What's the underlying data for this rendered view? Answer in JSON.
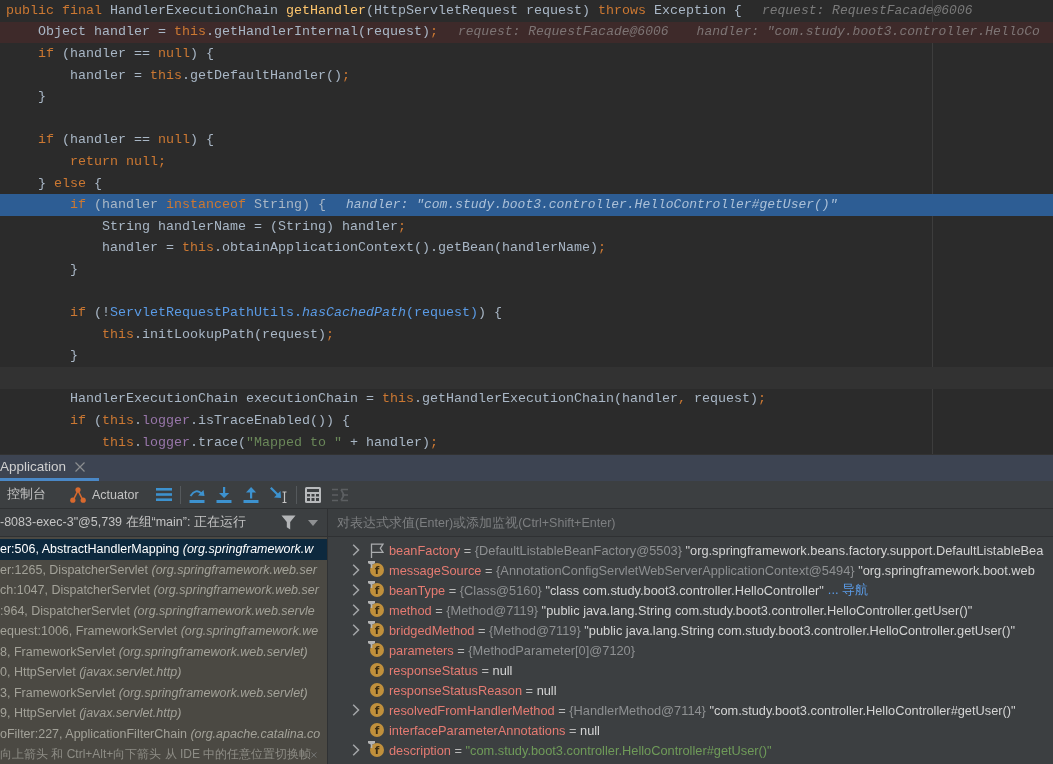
{
  "editor": {
    "lines": [
      {
        "kind": "normal",
        "tokens": [
          {
            "kind": "keyword",
            "text": "public final "
          },
          {
            "kind": "plain",
            "text": "HandlerExecutionChain "
          },
          {
            "kind": "declaration",
            "text": "getHandler"
          },
          {
            "kind": "plain",
            "text": "(HttpServletRequest request) "
          },
          {
            "kind": "keyword",
            "text": "throws "
          },
          {
            "kind": "plain",
            "text": "Exception {"
          }
        ],
        "hints": [
          "request: RequestFacade@6006"
        ]
      },
      {
        "kind": "breakpoint",
        "tokens": [
          {
            "kind": "plain",
            "text": "    Object handler = "
          },
          {
            "kind": "keyword",
            "text": "this"
          },
          {
            "kind": "plain",
            "text": ".getHandlerInternal(request)"
          },
          {
            "kind": "keyword",
            "text": ";"
          }
        ],
        "hints": [
          "request: RequestFacade@6006",
          "handler: \"com.study.boot3.controller.HelloCo"
        ]
      },
      {
        "kind": "normal",
        "tokens": [
          {
            "kind": "keyword",
            "text": "    if"
          },
          {
            "kind": "plain",
            "text": " (handler == "
          },
          {
            "kind": "keyword",
            "text": "null"
          },
          {
            "kind": "plain",
            "text": ") {"
          }
        ]
      },
      {
        "kind": "normal",
        "tokens": [
          {
            "kind": "plain",
            "text": "        handler = "
          },
          {
            "kind": "keyword",
            "text": "this"
          },
          {
            "kind": "plain",
            "text": ".getDefaultHandler()"
          },
          {
            "kind": "keyword",
            "text": ";"
          }
        ]
      },
      {
        "kind": "normal",
        "tokens": [
          {
            "kind": "plain",
            "text": "    }"
          }
        ]
      },
      {
        "kind": "normal"
      },
      {
        "kind": "normal",
        "tokens": [
          {
            "kind": "keyword",
            "text": "    if"
          },
          {
            "kind": "plain",
            "text": " (handler == "
          },
          {
            "kind": "keyword",
            "text": "null"
          },
          {
            "kind": "plain",
            "text": ") {"
          }
        ]
      },
      {
        "kind": "normal",
        "tokens": [
          {
            "kind": "keyword",
            "text": "        return null;"
          }
        ]
      },
      {
        "kind": "normal",
        "tokens": [
          {
            "kind": "plain",
            "text": "    } "
          },
          {
            "kind": "keyword",
            "text": "else"
          },
          {
            "kind": "plain",
            "text": " {"
          }
        ]
      },
      {
        "kind": "execution",
        "tokens": [
          {
            "kind": "keyword",
            "text": "        if"
          },
          {
            "kind": "plain",
            "text": " (handler "
          },
          {
            "kind": "keyword",
            "text": "instanceof"
          },
          {
            "kind": "plain",
            "text": " String) {"
          }
        ],
        "hints": [
          "handler: \"com.study.boot3.controller.HelloController#getUser()\""
        ]
      },
      {
        "kind": "normal",
        "tokens": [
          {
            "kind": "plain",
            "text": "            String handlerName = (String) handler"
          },
          {
            "kind": "keyword",
            "text": ";"
          }
        ]
      },
      {
        "kind": "normal",
        "tokens": [
          {
            "kind": "plain",
            "text": "            handler = "
          },
          {
            "kind": "keyword",
            "text": "this"
          },
          {
            "kind": "plain",
            "text": ".obtainApplicationContext().getBean(handlerName)"
          },
          {
            "kind": "keyword",
            "text": ";"
          }
        ]
      },
      {
        "kind": "normal",
        "tokens": [
          {
            "kind": "plain",
            "text": "        }"
          }
        ]
      },
      {
        "kind": "normal"
      },
      {
        "kind": "normal",
        "tokens": [
          {
            "kind": "keyword",
            "text": "        if"
          },
          {
            "kind": "plain",
            "text": " (!"
          },
          {
            "kind": "reference",
            "text": "ServletRequestPathUtils."
          },
          {
            "kind": "reference-italic",
            "text": "hasCachedPath"
          },
          {
            "kind": "reference",
            "text": "(request)"
          },
          {
            "kind": "plain",
            "text": ") {"
          }
        ]
      },
      {
        "kind": "normal",
        "tokens": [
          {
            "kind": "keyword",
            "text": "            this"
          },
          {
            "kind": "plain",
            "text": ".initLookupPath(request)"
          },
          {
            "kind": "keyword",
            "text": ";"
          }
        ]
      },
      {
        "kind": "normal",
        "tokens": [
          {
            "kind": "plain",
            "text": "        }"
          }
        ]
      },
      {
        "kind": "caret"
      },
      {
        "kind": "normal",
        "tokens": [
          {
            "kind": "plain",
            "text": "        HandlerExecutionChain executionChain = "
          },
          {
            "kind": "keyword",
            "text": "this"
          },
          {
            "kind": "plain",
            "text": ".getHandlerExecutionChain(handler"
          },
          {
            "kind": "keyword",
            "text": ","
          },
          {
            "kind": "plain",
            "text": " request)"
          },
          {
            "kind": "keyword",
            "text": ";"
          }
        ]
      },
      {
        "kind": "normal",
        "tokens": [
          {
            "kind": "keyword",
            "text": "        if"
          },
          {
            "kind": "plain",
            "text": " ("
          },
          {
            "kind": "keyword",
            "text": "this"
          },
          {
            "kind": "plain",
            "text": "."
          },
          {
            "kind": "field",
            "text": "logger"
          },
          {
            "kind": "plain",
            "text": ".isTraceEnabled()) {"
          }
        ]
      },
      {
        "kind": "normal",
        "tokens": [
          {
            "kind": "keyword",
            "text": "            this"
          },
          {
            "kind": "plain",
            "text": "."
          },
          {
            "kind": "field",
            "text": "logger"
          },
          {
            "kind": "plain",
            "text": ".trace("
          },
          {
            "kind": "string",
            "text": "\"Mapped to \""
          },
          {
            "kind": "plain",
            "text": " + handler)"
          },
          {
            "kind": "keyword",
            "text": ";"
          }
        ]
      }
    ]
  },
  "run_tabs": [
    {
      "label": "Application",
      "selected": true
    }
  ],
  "debug_toolbar": {
    "tabs": [
      {
        "kind": "console",
        "label": "控制台",
        "selected": false
      },
      {
        "kind": "actuator",
        "label": "Actuator",
        "selected": false
      }
    ],
    "action_groups": [
      [
        {
          "kind": "layout",
          "disabled": false
        }
      ],
      [
        {
          "kind": "step-over",
          "disabled": false
        },
        {
          "kind": "step-into",
          "disabled": false
        },
        {
          "kind": "step-out",
          "disabled": false
        },
        {
          "kind": "run-to-cursor",
          "disabled": false
        }
      ],
      [
        {
          "kind": "evaluate",
          "disabled": false
        },
        {
          "kind": "trace",
          "disabled": true
        }
      ]
    ]
  },
  "frames": {
    "thread": "-8083-exec-3\"@5,739 在组“main”: 正在运行",
    "items": [
      {
        "label": "er:506, AbstractHandlerMapping *(org.springframework.w*",
        "selected": true
      },
      {
        "label": "er:1265, DispatcherServlet *(org.springframework.web.ser*",
        "selected": false
      },
      {
        "label": "ch:1047, DispatcherServlet *(org.springframework.web.ser*",
        "selected": false
      },
      {
        "label": ":964, DispatcherServlet *(org.springframework.web.servle*",
        "selected": false
      },
      {
        "label": "equest:1006, FrameworkServlet *(org.springframework.we*",
        "selected": false
      },
      {
        "label": "8, FrameworkServlet *(org.springframework.web.servlet)*",
        "selected": false
      },
      {
        "label": "0, HttpServlet *(javax.servlet.http)*",
        "selected": false
      },
      {
        "label": "3, FrameworkServlet *(org.springframework.web.servlet)*",
        "selected": false
      },
      {
        "label": "9, HttpServlet *(javax.servlet.http)*",
        "selected": false
      },
      {
        "label": "oFilter:227, ApplicationFilterChain *(org.apache.catalina.co*",
        "selected": false
      }
    ],
    "tip": "向上箭头 和 Ctrl+Alt+向下箭头 从 IDE 中的任意位置切换帧"
  },
  "variables": {
    "placeholder": "对表达式求值(Enter)或添加监视(Ctrl+Shift+Enter)",
    "items": [
      {
        "kind": "flag",
        "name": "beanFactory",
        "operator": "=",
        "type": "{DefaultListableBeanFactory@5503}",
        "value": "\"org.springframework.beans.factory.support.DefaultListableBea",
        "expandable": true,
        "final": false
      },
      {
        "kind": "field",
        "icon_text": "f",
        "name": "messageSource",
        "operator": "=",
        "type": "{AnnotationConfigServletWebServerApplicationContext@5494}",
        "value": "\"org.springframework.boot.web",
        "expandable": true,
        "final": true
      },
      {
        "kind": "field",
        "icon_text": "f",
        "name": "beanType",
        "operator": "=",
        "type": "{Class@5160}",
        "value": "\"class com.study.boot3.controller.HelloController\"",
        "link": "... 导航",
        "expandable": true,
        "final": true
      },
      {
        "kind": "field",
        "icon_text": "f",
        "name": "method",
        "operator": "=",
        "type": "{Method@7119}",
        "value": "\"public java.lang.String com.study.boot3.controller.HelloController.getUser()\"",
        "expandable": true,
        "final": true
      },
      {
        "kind": "field",
        "icon_text": "f",
        "name": "bridgedMethod",
        "operator": "=",
        "type": "{Method@7119}",
        "value": "\"public java.lang.String com.study.boot3.controller.HelloController.getUser()\"",
        "expandable": true,
        "final": true
      },
      {
        "kind": "field",
        "icon_text": "f",
        "name": "parameters",
        "operator": "=",
        "type": "{MethodParameter[0]@7120}",
        "expandable": false,
        "final": true
      },
      {
        "kind": "field",
        "icon_text": "f",
        "name": "responseStatus",
        "operator": "=",
        "value": "null",
        "expandable": false,
        "final": false
      },
      {
        "kind": "field",
        "icon_text": "f",
        "name": "responseStatusReason",
        "operator": "=",
        "value": "null",
        "expandable": false,
        "final": false
      },
      {
        "kind": "field",
        "icon_text": "f",
        "name": "resolvedFromHandlerMethod",
        "operator": "=",
        "type": "{HandlerMethod@7114}",
        "value": "\"com.study.boot3.controller.HelloController#getUser()\"",
        "expandable": true,
        "final": false
      },
      {
        "kind": "field",
        "icon_text": "f",
        "name": "interfaceParameterAnnotations",
        "operator": "=",
        "value": "null",
        "expandable": false,
        "final": false
      },
      {
        "kind": "string-field",
        "icon_text": "f",
        "name": "description",
        "operator": "=",
        "value": "\"com.study.boot3.controller.HelloController#getUser()\"",
        "expandable": true,
        "final": true
      }
    ]
  }
}
